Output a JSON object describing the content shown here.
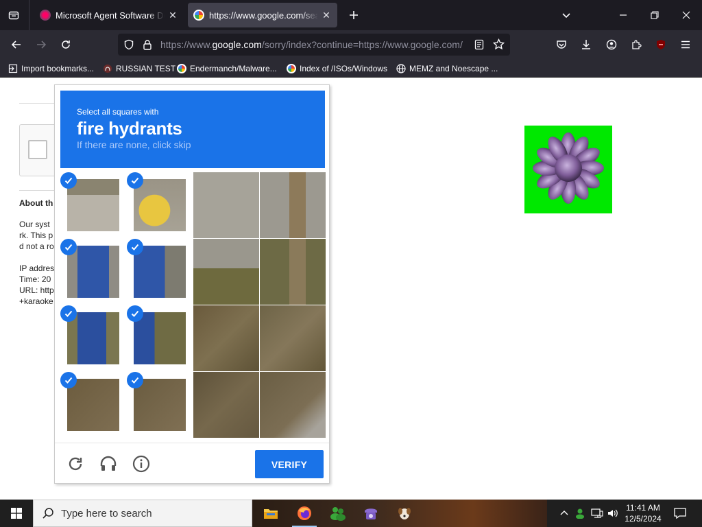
{
  "browser": {
    "tabs": [
      {
        "title": "Microsoft Agent Software Down",
        "active": false
      },
      {
        "title": "https://www.google.com/searc",
        "active": true
      }
    ],
    "url": {
      "prefix": "https://www.",
      "domain": "google.com",
      "suffix": "/sorry/index?continue=https://www.google.com/"
    },
    "bookmarks": [
      {
        "label": "Import bookmarks...",
        "icon": "import-icon"
      },
      {
        "label": "RUSSIAN TEST",
        "icon": "github-icon"
      },
      {
        "label": "Endermanch/Malware...",
        "icon": "google-icon"
      },
      {
        "label": "Index of /ISOs/Windows",
        "icon": "google-icon"
      },
      {
        "label": "MEMZ and Noescape ...",
        "icon": "globe-icon"
      }
    ]
  },
  "page": {
    "about_heading": "About th",
    "lines": [
      "Our syst",
      "rk. This p",
      "d not a ro",
      "IP addres",
      "Time: 20",
      "URL: http",
      "+karaoke"
    ]
  },
  "captcha": {
    "instruction": "Select all squares with",
    "target": "fire hydrants",
    "hint": "If there are none, click skip",
    "verify_label": "VERIFY",
    "selected": [
      0,
      1,
      4,
      5,
      8,
      9,
      12,
      13
    ],
    "accent": "#1a73e8"
  },
  "taskbar": {
    "search_placeholder": "Type here to search",
    "time": "11:41 AM",
    "date": "12/5/2024"
  }
}
